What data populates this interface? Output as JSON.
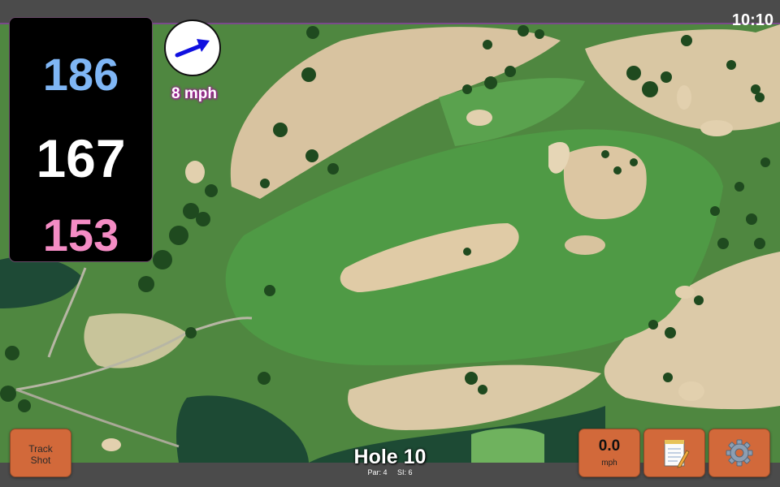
{
  "status_bar": {
    "time": "10:10"
  },
  "distances": {
    "back": "186",
    "middle": "167",
    "front": "153"
  },
  "wind": {
    "speed_label": "8 mph",
    "direction_icon": "arrow-icon"
  },
  "buttons": {
    "track_shot": {
      "line1": "Track",
      "line2": "Shot"
    },
    "speed": {
      "value": "0.0",
      "unit": "mph"
    },
    "notes_icon": "notepad-icon",
    "settings_icon": "gear-icon"
  },
  "hole": {
    "title": "Hole 10",
    "par": "Par: 4",
    "si": "SI: 6"
  },
  "colors": {
    "back_distance": "#7fb6f5",
    "middle_distance": "#ffffff",
    "front_distance": "#f48cc4",
    "button_bg": "#d2693a",
    "wind_arrow": "#1010e0"
  }
}
